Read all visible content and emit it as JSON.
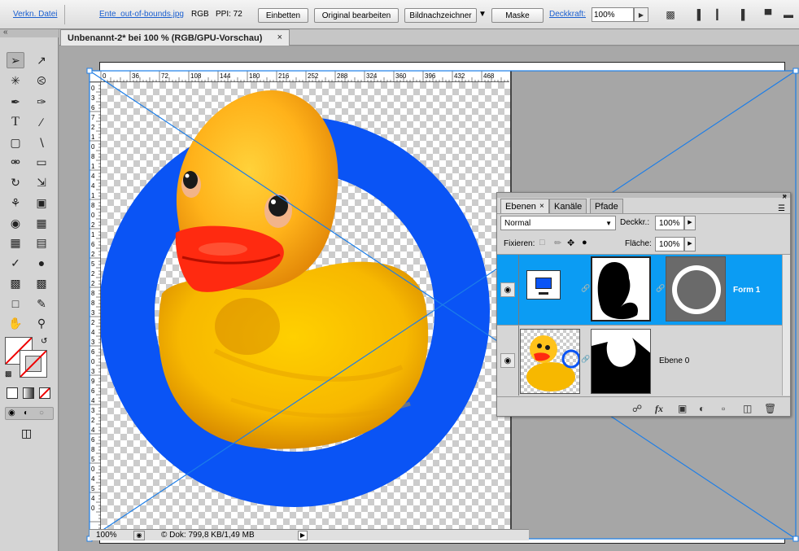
{
  "controlbar": {
    "link_file": "Verkn. Datei",
    "filename": "Ente_out-of-bounds.jpg",
    "colormode": "RGB",
    "ppi": "PPI: 72",
    "embed": "Einbetten",
    "edit_original": "Original bearbeiten",
    "brush_drawer": "Bildnachzeichner",
    "mask": "Maske",
    "opacity_label": "Deckkraft:",
    "opacity_value": "100%"
  },
  "tabbar": {
    "collapse": "«",
    "doc_title": "Unbenannt-2* bei 100 % (RGB/GPU-Vorschau)",
    "close": "×"
  },
  "rulers": {
    "top_ticks": [
      "0",
      "36",
      "72",
      "108",
      "144",
      "180",
      "216",
      "252",
      "288",
      "324",
      "360",
      "396",
      "432",
      "468"
    ],
    "left_ticks": [
      "0",
      "3",
      "6",
      "7",
      "2",
      "1",
      "0",
      "8",
      "1",
      "4",
      "4",
      "1",
      "8",
      "0",
      "2",
      "1",
      "6",
      "2",
      "5",
      "2",
      "2",
      "8",
      "8",
      "3",
      "2",
      "4",
      "3",
      "6",
      "0",
      "3",
      "9",
      "6",
      "4",
      "3",
      "2",
      "4",
      "6",
      "8",
      "5",
      "0",
      "4",
      "5",
      "4",
      "0"
    ]
  },
  "status": {
    "zoom": "100%",
    "doc": "© Dok: 799,8 KB/1,49 MB"
  },
  "layers_panel": {
    "tabs": [
      "Ebenen",
      "Kanäle",
      "Pfade"
    ],
    "blend_mode": "Normal",
    "opacity_label": "Deckkr.:",
    "opacity_value": "100%",
    "lock_label": "Fixieren:",
    "fill_label": "Fläche:",
    "fill_value": "100%",
    "layers": [
      {
        "name": "Form 1",
        "selected": true
      },
      {
        "name": "Ebene 0",
        "selected": false
      }
    ]
  },
  "icons": {
    "colors": {
      "accent_blue": "#0a54f5",
      "selection_blue": "#0b9cf3",
      "duck_yellow": "#ffc21a"
    }
  }
}
